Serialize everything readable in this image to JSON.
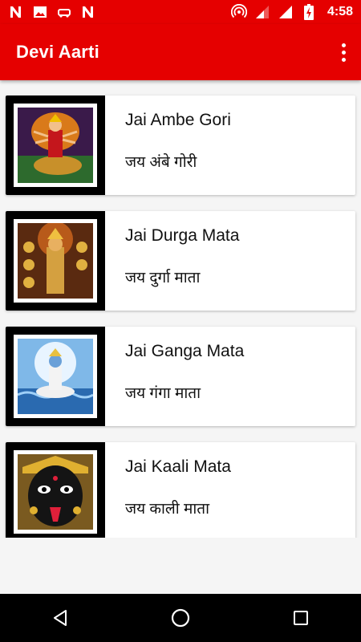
{
  "status_bar": {
    "time": "4:58",
    "left_icons": [
      "n-logo-icon",
      "image-icon",
      "car-icon",
      "n-logo-icon"
    ],
    "right_icons": [
      "hotspot-icon",
      "signal-icon",
      "signal-full-icon",
      "battery-charging-icon"
    ]
  },
  "toolbar": {
    "title": "Devi Aarti",
    "menu_icon": "more-vert-icon",
    "color": "#e50000"
  },
  "list": {
    "items": [
      {
        "title_en": "Jai Ambe Gori",
        "title_hi": "जय अंबे गोरी",
        "image": "durga-on-lion-image"
      },
      {
        "title_en": "Jai Durga Mata",
        "title_hi": "जय दुर्गा माता",
        "image": "durga-idol-image"
      },
      {
        "title_en": "Jai Ganga Mata",
        "title_hi": "जय गंगा माता",
        "image": "ganga-image"
      },
      {
        "title_en": "Jai Kaali Mata",
        "title_hi": "जय काली माता",
        "image": "kaali-image"
      }
    ]
  },
  "nav_bar": {
    "buttons": [
      "back-icon",
      "home-icon",
      "recents-icon"
    ]
  }
}
